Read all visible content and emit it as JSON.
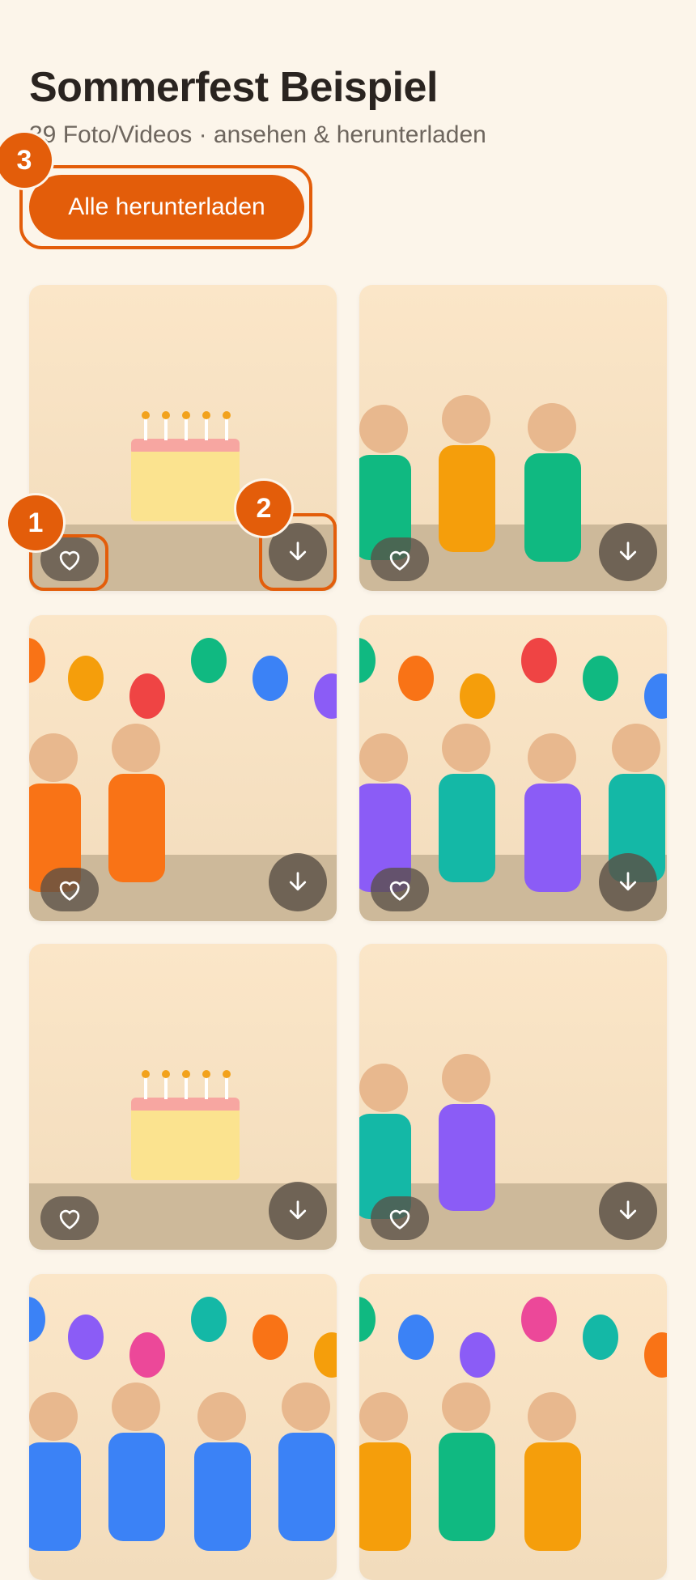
{
  "header": {
    "title": "Sommerfest Beispiel",
    "subtitle": "39 Foto/Videos · ansehen & herunterladen"
  },
  "actions": {
    "download_all_label": "Alle herunterladen"
  },
  "markers": {
    "m1": "1",
    "m2": "2",
    "m3": "3"
  },
  "colors": {
    "accent": "#e35d0a",
    "background": "#fcf5ea"
  },
  "tiles": [
    {
      "scene": "cake"
    },
    {
      "scene": "people"
    },
    {
      "scene": "balloons-people"
    },
    {
      "scene": "balloons-people"
    },
    {
      "scene": "cake"
    },
    {
      "scene": "people"
    },
    {
      "scene": "balloons-people"
    },
    {
      "scene": "balloons-people"
    }
  ]
}
